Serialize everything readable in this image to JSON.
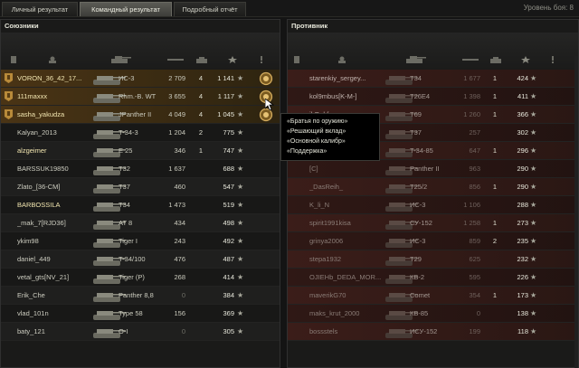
{
  "tabs": [
    "Личный результат",
    "Командный результат",
    "Подробный отчёт"
  ],
  "active_tab": 1,
  "battle_level": "Уровень боя: 8",
  "allies": {
    "title": "Союзники",
    "rows": [
      {
        "name": "VORON_36_42_17...",
        "tank": "ИС-3",
        "dmg": "2 709",
        "frags": "4",
        "xp": "1 141",
        "medal": true,
        "platoon": true
      },
      {
        "name": "111maxxx",
        "tank": "Rhm.-B. WT",
        "dmg": "3 655",
        "frags": "4",
        "xp": "1 117",
        "medal": true,
        "platoon": true
      },
      {
        "name": "sasha_yakudza",
        "tank": "JPanther II",
        "dmg": "4 049",
        "frags": "4",
        "xp": "1 045",
        "medal": true,
        "platoon": true
      },
      {
        "name": "Kalyan_2013",
        "tank": "T-34-3",
        "dmg": "1 204",
        "frags": "2",
        "xp": "775"
      },
      {
        "name": "alzgeimer",
        "tank": "E 25",
        "dmg": "346",
        "frags": "1",
        "xp": "747"
      },
      {
        "name": "BARSSUK19850",
        "tank": "T32",
        "dmg": "1 637",
        "frags": "",
        "xp": "688"
      },
      {
        "name": "Zlato_[36-CM]",
        "tank": "T37",
        "dmg": "460",
        "frags": "",
        "xp": "547"
      },
      {
        "name": "BARBOSSILA",
        "tank": "T34",
        "dmg": "1 473",
        "frags": "",
        "xp": "519"
      },
      {
        "name": "_mak_7[RJD36]",
        "tank": "AT 8",
        "dmg": "434",
        "frags": "",
        "xp": "498"
      },
      {
        "name": "ykim98",
        "tank": "Tiger I",
        "dmg": "243",
        "frags": "",
        "xp": "492"
      },
      {
        "name": "daniel_449",
        "tank": "T-34/100",
        "dmg": "476",
        "frags": "",
        "xp": "487"
      },
      {
        "name": "vetal_gts[NV_21]",
        "tank": "Tiger (P)",
        "dmg": "268",
        "frags": "",
        "xp": "414"
      },
      {
        "name": "Erik_Che",
        "tank": "Panther 8,8",
        "dmg": "0",
        "frags": "",
        "xp": "384"
      },
      {
        "name": "vlad_101n",
        "tank": "Type 58",
        "dmg": "156",
        "frags": "",
        "xp": "369"
      },
      {
        "name": "baty_121",
        "tank": "O-I",
        "dmg": "0",
        "frags": "",
        "xp": "305"
      }
    ]
  },
  "enemies": {
    "title": "Противник",
    "rows": [
      {
        "name": "starenkiy_sergey...",
        "tank": "T34",
        "dmg": "1 677",
        "frags": "1",
        "xp": "424"
      },
      {
        "name": "kol9mbus[K-M-]",
        "tank": "T26E4",
        "dmg": "1 398",
        "frags": "1",
        "xp": "411"
      },
      {
        "name": "ihDukfran",
        "tank": "T69",
        "dmg": "1 260",
        "frags": "1",
        "xp": "366"
      },
      {
        "name": "",
        "tank": "T37",
        "dmg": "257",
        "frags": "",
        "xp": "302"
      },
      {
        "name": "",
        "tank": "T-34-85",
        "dmg": "647",
        "frags": "1",
        "xp": "296"
      },
      {
        "name": "[C]",
        "tank": "Panther II",
        "dmg": "963",
        "frags": "",
        "xp": "290"
      },
      {
        "name": "_DasReih_",
        "tank": "T25/2",
        "dmg": "856",
        "frags": "1",
        "xp": "290"
      },
      {
        "name": "K_li_N",
        "tank": "ИС-3",
        "dmg": "1 106",
        "frags": "",
        "xp": "288"
      },
      {
        "name": "spirit1991kisa",
        "tank": "СУ-152",
        "dmg": "1 258",
        "frags": "1",
        "xp": "273"
      },
      {
        "name": "grinya2006",
        "tank": "ИС-3",
        "dmg": "859",
        "frags": "2",
        "xp": "235"
      },
      {
        "name": "stepa1932",
        "tank": "T29",
        "dmg": "625",
        "frags": "",
        "xp": "232"
      },
      {
        "name": "OJIEHb_DEDA_MOR...",
        "tank": "КВ-2",
        "dmg": "595",
        "frags": "",
        "xp": "226"
      },
      {
        "name": "maverikG70",
        "tank": "Comet",
        "dmg": "354",
        "frags": "1",
        "xp": "173"
      },
      {
        "name": "maks_krut_2000",
        "tank": "КВ-85",
        "dmg": "0",
        "frags": "",
        "xp": "138"
      },
      {
        "name": "bossstels",
        "tank": "ИСУ-152",
        "dmg": "199",
        "frags": "",
        "xp": "118"
      }
    ]
  },
  "tooltip": [
    "«Братья по оружию»",
    "«Решающий вклад»",
    "«Основной калибр»",
    "«Поддержка»"
  ],
  "colors": {
    "platoon": "#4a3415",
    "enemy_row": "#3b1d19",
    "gold": "#d8b060",
    "tab_active": "#4d4d48"
  },
  "icons": {
    "star": "★",
    "medal": "medal-icon",
    "platoon": "platoon-badge-icon"
  }
}
